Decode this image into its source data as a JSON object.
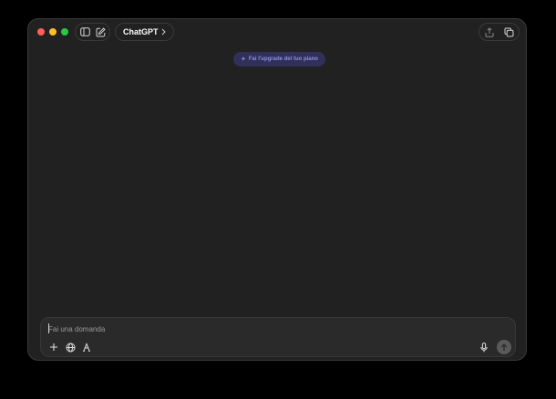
{
  "window": {
    "traffic_lights": [
      "close",
      "minimize",
      "zoom"
    ]
  },
  "titlebar": {
    "model_name": "ChatGPT",
    "left_icons": [
      "sidebar-icon",
      "compose-icon"
    ],
    "right_icons": [
      "share-icon",
      "new-window-icon"
    ]
  },
  "banner": {
    "upgrade_label": "Fai l'upgrade del tuo piano"
  },
  "composer": {
    "placeholder": "Fai una domanda",
    "value": "",
    "left_icons": [
      "plus-icon",
      "globe-icon",
      "tools-icon"
    ],
    "right_icons": [
      "microphone-icon",
      "send-arrow-icon"
    ]
  },
  "colors": {
    "background": "#000000",
    "window": "#212121",
    "composer": "#2a2a2a",
    "upgrade_bg": "#30305a",
    "upgrade_text": "#8f8fe0"
  }
}
